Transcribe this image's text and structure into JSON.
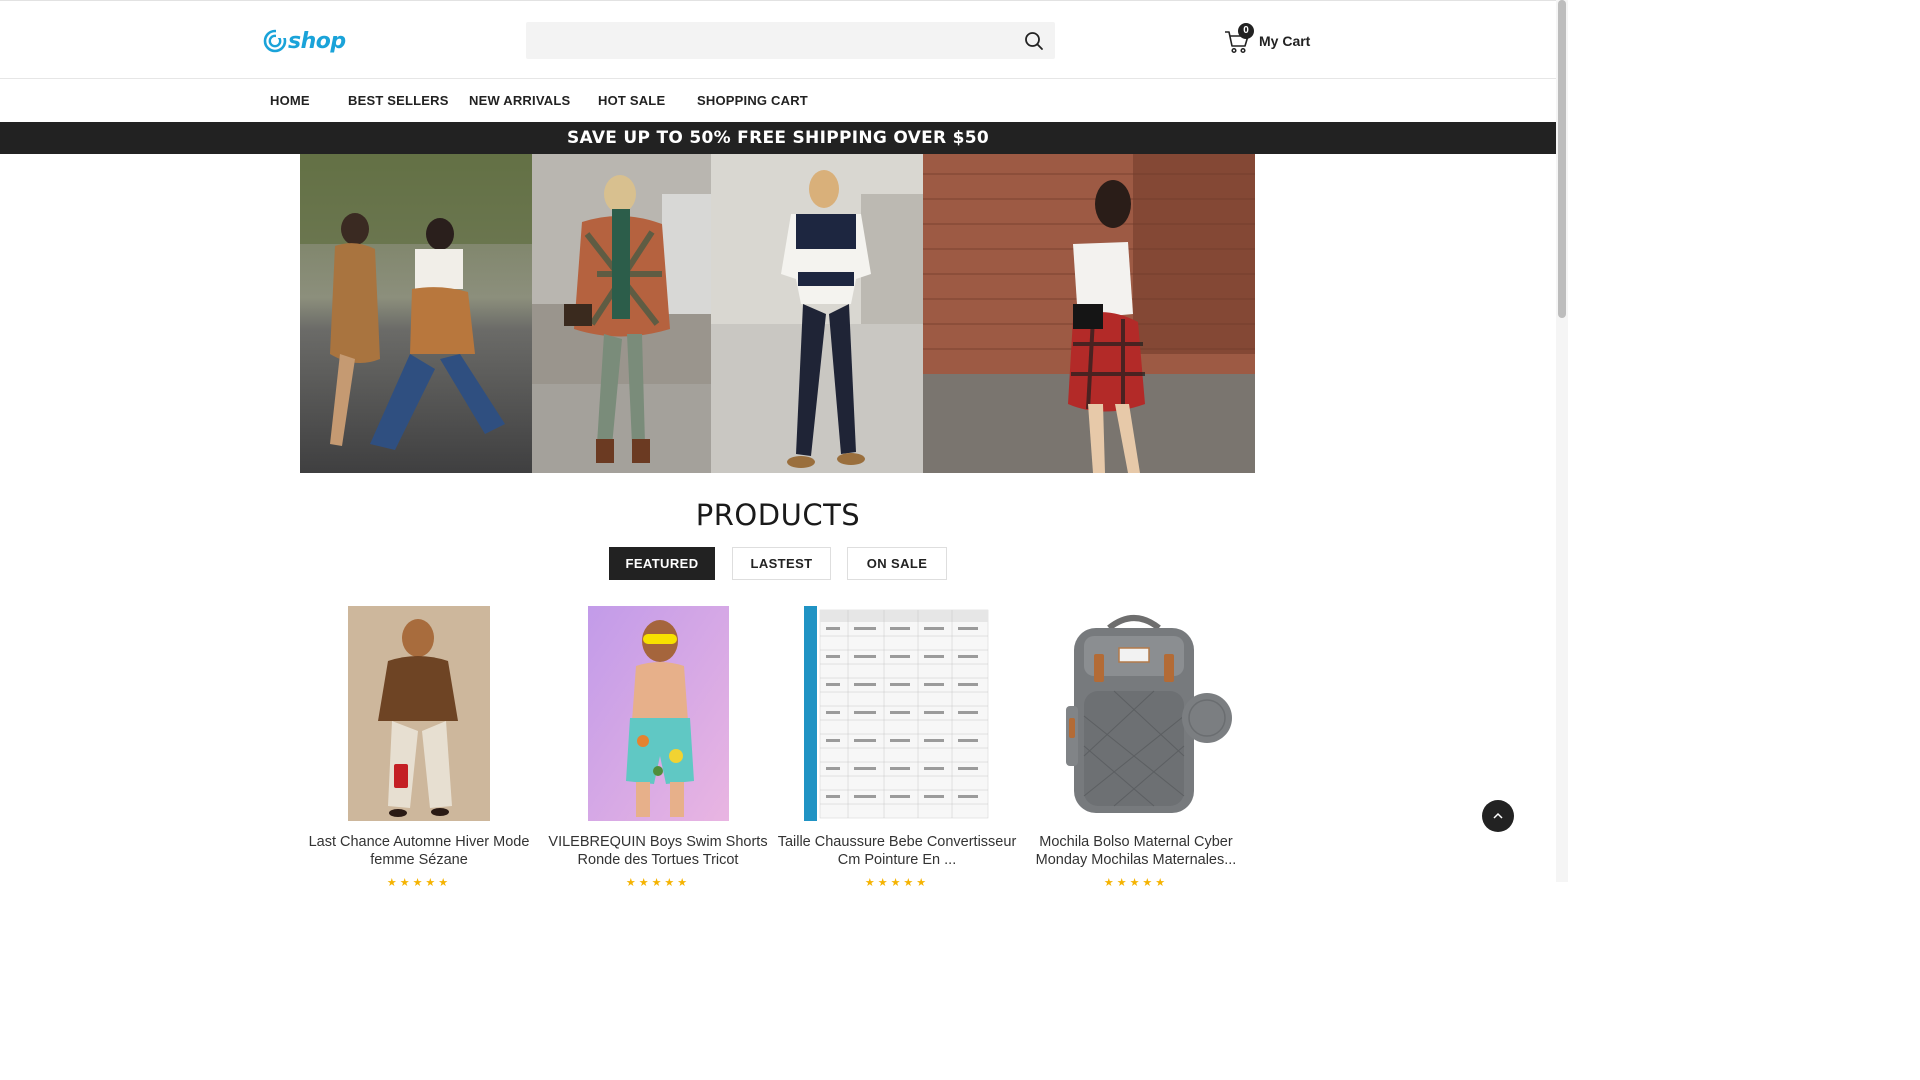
{
  "header": {
    "logo_text": "shop",
    "search": {
      "value": "",
      "placeholder": ""
    },
    "cart": {
      "count": "0",
      "label": "My Cart"
    }
  },
  "nav": {
    "items": [
      {
        "label": "HOME"
      },
      {
        "label": "BEST SELLERS"
      },
      {
        "label": "NEW ARRIVALS"
      },
      {
        "label": "HOT SALE"
      },
      {
        "label": "SHOPPING CART"
      }
    ]
  },
  "promo": {
    "text": "SAVE UP TO 50% FREE SHIPPING OVER $50"
  },
  "products_section": {
    "title": "PRODUCTS",
    "tabs": [
      {
        "label": "FEATURED",
        "active": true
      },
      {
        "label": "LASTEST",
        "active": false
      },
      {
        "label": "ON SALE",
        "active": false
      }
    ],
    "items": [
      {
        "title": "Last Chance Automne Hiver Mode femme Sézane",
        "stars": "★★★★★"
      },
      {
        "title": "VILEBREQUIN Boys Swim Shorts Ronde des Tortues Tricot",
        "stars": "★★★★★"
      },
      {
        "title": "Taille Chaussure Bebe Convertisseur Cm Pointure En ...",
        "stars": "★★★★★"
      },
      {
        "title": "Mochila Bolso Maternal Cyber Monday Mochilas Maternales...",
        "stars": "★★★★★"
      }
    ]
  },
  "colors": {
    "brand": "#1aa3d9",
    "dark": "#222222",
    "star": "#f5b301"
  }
}
